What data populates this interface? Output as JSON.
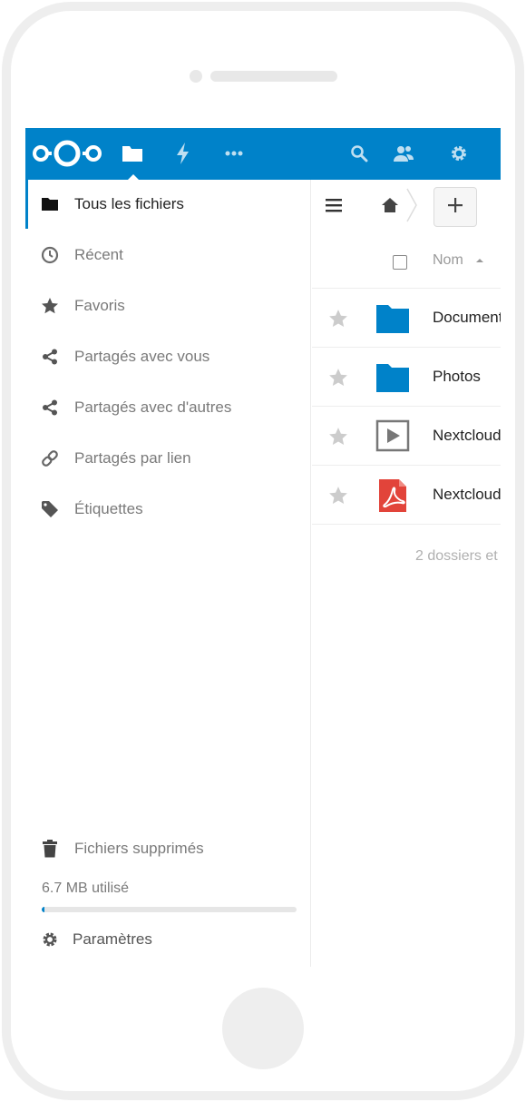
{
  "colors": {
    "brand": "#0082c9",
    "pdf": "#e2443a"
  },
  "topbar": {
    "logo_icon": "nextcloud-logo",
    "icons": [
      "files-icon",
      "activity-icon",
      "more-apps-icon",
      "search-icon",
      "contacts-icon",
      "settings-icon"
    ]
  },
  "sidebar": {
    "items": [
      {
        "label": "Tous les fichiers",
        "icon": "folder-icon"
      },
      {
        "label": "Récent",
        "icon": "clock-icon"
      },
      {
        "label": "Favoris",
        "icon": "star-icon"
      },
      {
        "label": "Partagés avec vous",
        "icon": "share-icon"
      },
      {
        "label": "Partagés avec d'autres",
        "icon": "share-icon"
      },
      {
        "label": "Partagés par lien",
        "icon": "link-icon"
      },
      {
        "label": "Étiquettes",
        "icon": "tag-icon"
      }
    ],
    "trash_label": "Fichiers supprimés",
    "quota_text": "6.7 MB utilisé",
    "quota_fraction": 0.01,
    "settings_label": "Paramètres"
  },
  "main": {
    "column_name": "Nom",
    "files": [
      {
        "name": "Document",
        "type": "folder"
      },
      {
        "name": "Photos",
        "type": "folder"
      },
      {
        "name": "Nextcloud",
        "type": "video"
      },
      {
        "name": "Nextcloud",
        "type": "pdf"
      }
    ],
    "summary": "2 dossiers et"
  }
}
